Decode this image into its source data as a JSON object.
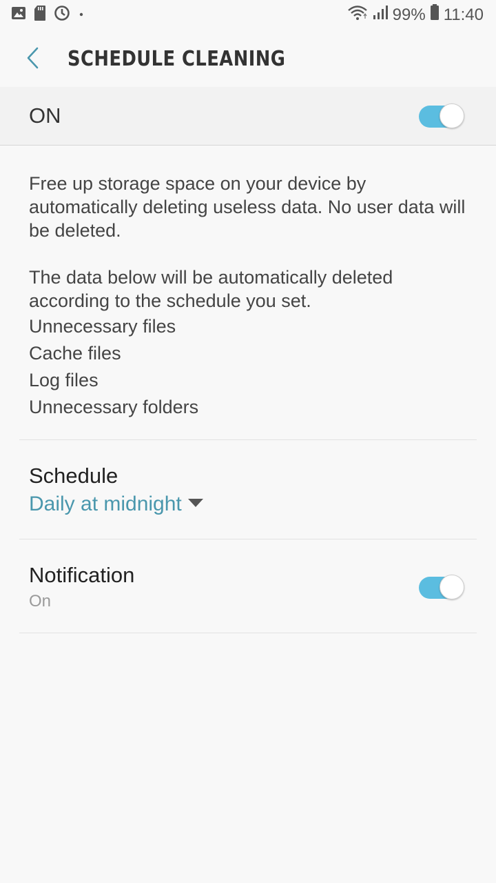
{
  "status_bar": {
    "battery": "99%",
    "time": "11:40",
    "icons": [
      "image-icon",
      "sd-card-icon",
      "sync-icon",
      "dot-icon",
      "wifi-icon",
      "signal-icon",
      "battery-icon"
    ]
  },
  "app_bar": {
    "title": "SCHEDULE CLEANING",
    "back_icon": "chevron-left-icon"
  },
  "master": {
    "label": "ON",
    "enabled": true
  },
  "description": {
    "para1": "Free up storage space on your device by automatically deleting useless data. No user data will be deleted.",
    "para2": "The data below will be automatically deleted according to the schedule you set.",
    "items": [
      "Unnecessary files",
      "Cache files",
      "Log files",
      "Unnecessary folders"
    ]
  },
  "schedule": {
    "title": "Schedule",
    "value": "Daily at midnight"
  },
  "notification": {
    "title": "Notification",
    "status": "On",
    "enabled": true
  },
  "colors": {
    "accent": "#4a97ad",
    "switch_track": "#5bbde0",
    "background": "#f8f8f8"
  }
}
